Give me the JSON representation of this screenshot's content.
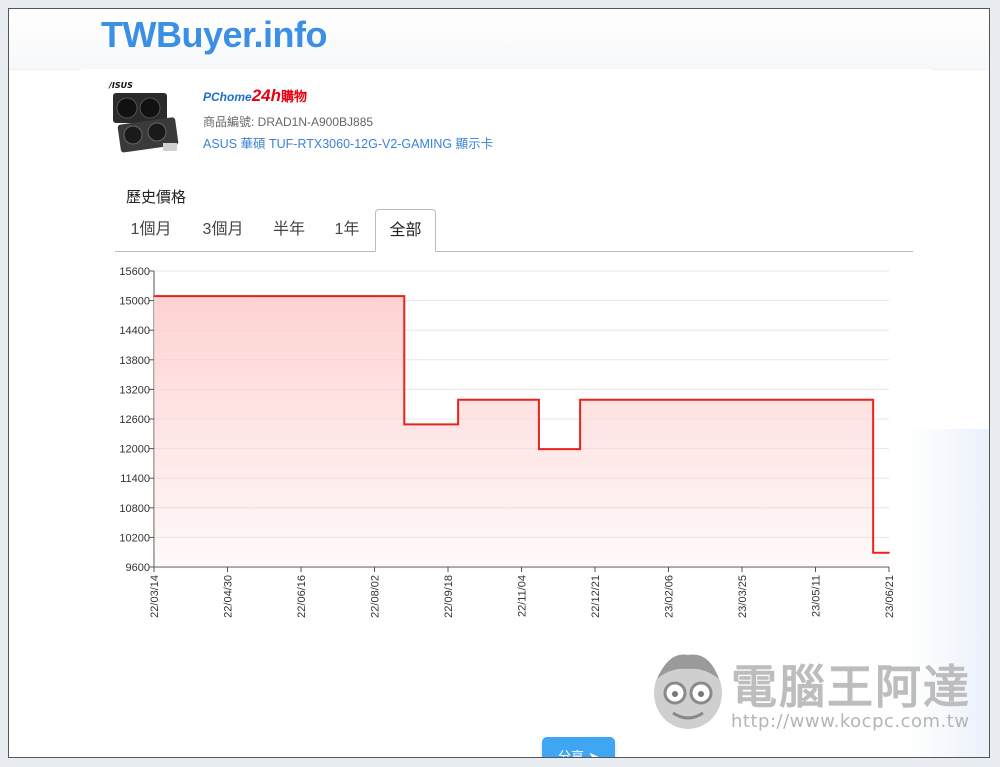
{
  "site": {
    "logo": "TWBuyer.info"
  },
  "product": {
    "store_logo": {
      "part1": "PChome",
      "part2": "24h",
      "part3": "購物"
    },
    "code": "商品編號: DRAD1N-A900BJ885",
    "name": "ASUS 華碩 TUF-RTX3060-12G-V2-GAMING 顯示卡"
  },
  "history_title": "歷史價格",
  "tabs": [
    "1個月",
    "3個月",
    "半年",
    "1年",
    "全部"
  ],
  "active_tab": "全部",
  "share": {
    "label": "分享"
  },
  "watermark": {
    "text": "電腦王阿達",
    "url": "http://www.kocpc.com.tw"
  },
  "colors": {
    "line": "#e8231c",
    "fill": "#ffd0d0",
    "accent": "#3ea6f2",
    "logo": "#3b8fe5"
  },
  "chart_data": {
    "type": "line",
    "step": true,
    "x_tick_labels": [
      "22/03/14",
      "22/04/30",
      "22/06/16",
      "22/08/02",
      "22/09/18",
      "22/11/04",
      "22/12/21",
      "23/02/06",
      "23/03/25",
      "23/05/11",
      "23/06/21"
    ],
    "y_ticks": [
      9600,
      10200,
      10800,
      11400,
      12000,
      12600,
      13200,
      13800,
      14400,
      15000,
      15600
    ],
    "ylim": [
      9600,
      15600
    ],
    "xlim": [
      "2022-03-14",
      "2023-06-21"
    ],
    "series": [
      {
        "points": [
          [
            "2022-03-14",
            15090
          ],
          [
            "2022-08-19",
            12490
          ],
          [
            "2022-09-22",
            12990
          ],
          [
            "2022-11-12",
            11990
          ],
          [
            "2022-12-08",
            12990
          ],
          [
            "2023-06-11",
            9890
          ],
          [
            "2023-06-21",
            9890
          ]
        ]
      }
    ],
    "grid": true
  }
}
